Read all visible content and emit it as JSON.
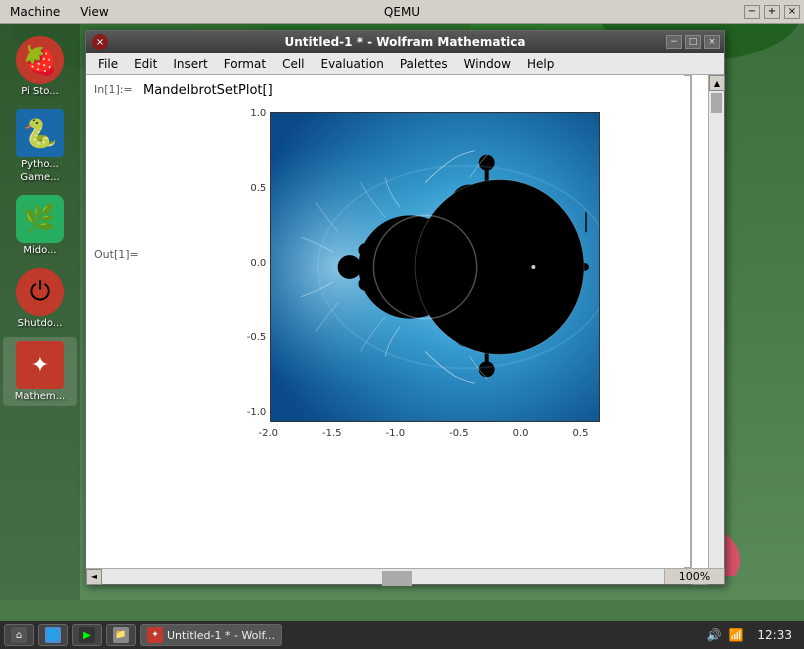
{
  "qemu": {
    "title": "QEMU",
    "menu": {
      "machine": "Machine",
      "view": "View"
    },
    "controls": {
      "minimize": "−",
      "maximize": "+",
      "close": "×"
    }
  },
  "sidebar": {
    "items": [
      {
        "id": "pi-store",
        "label": "Pi Sto...",
        "icon": "🍓"
      },
      {
        "id": "python-games",
        "label": "Pytho... Game...",
        "icon": "🐍"
      },
      {
        "id": "midori",
        "label": "Mido...",
        "icon": "🌿"
      },
      {
        "id": "shutdown",
        "label": "Shutdo...",
        "icon": "⏻"
      },
      {
        "id": "mathematica",
        "label": "Mathem...",
        "icon": "∑"
      }
    ]
  },
  "mathematica_window": {
    "title": "Untitled-1 * - Wolfram Mathematica",
    "controls": {
      "close": "×",
      "minimize": "−",
      "maximize": "□"
    },
    "menu": {
      "file": "File",
      "edit": "Edit",
      "insert": "Insert",
      "format": "Format",
      "cell": "Cell",
      "evaluation": "Evaluation",
      "palettes": "Palettes",
      "window": "Window",
      "help": "Help"
    },
    "cell_in": {
      "label": "In[1]:=",
      "content": "MandelbrotSetPlot[]"
    },
    "cell_out": {
      "label": "Out[1]="
    },
    "plot": {
      "x_labels": [
        "-2.0",
        "-1.5",
        "-1.0",
        "-0.5",
        "0.0",
        "0.5"
      ],
      "y_labels": [
        "1.0",
        "0.5",
        "0.0",
        "-0.5",
        "-1.0"
      ]
    },
    "zoom": "100%",
    "scrollbar_buttons": {
      "up": "▲",
      "down": "▼",
      "left": "◄",
      "right": "►"
    }
  },
  "taskbar": {
    "app_label": "Untitled-1 * - Wolf...",
    "time": "12:33"
  }
}
